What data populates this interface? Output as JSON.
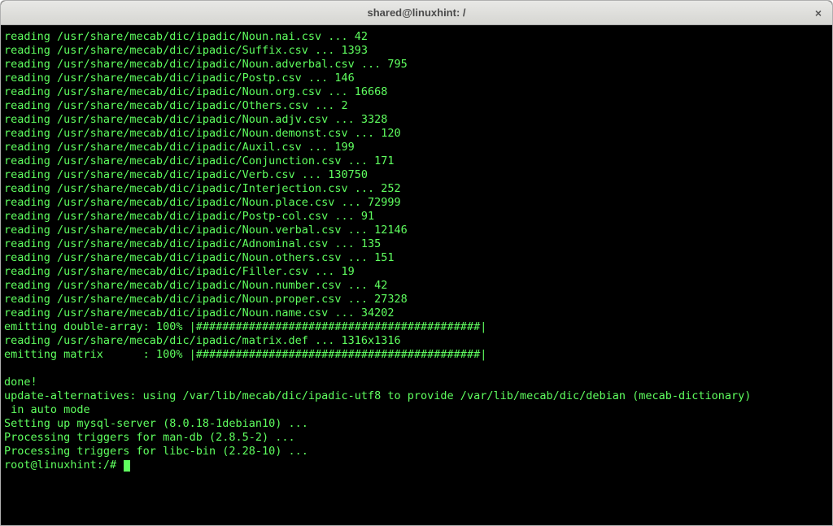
{
  "window": {
    "title": "shared@linuxhint: /"
  },
  "terminal": {
    "lines": [
      "reading /usr/share/mecab/dic/ipadic/Noun.nai.csv ... 42",
      "reading /usr/share/mecab/dic/ipadic/Suffix.csv ... 1393",
      "reading /usr/share/mecab/dic/ipadic/Noun.adverbal.csv ... 795",
      "reading /usr/share/mecab/dic/ipadic/Postp.csv ... 146",
      "reading /usr/share/mecab/dic/ipadic/Noun.org.csv ... 16668",
      "reading /usr/share/mecab/dic/ipadic/Others.csv ... 2",
      "reading /usr/share/mecab/dic/ipadic/Noun.adjv.csv ... 3328",
      "reading /usr/share/mecab/dic/ipadic/Noun.demonst.csv ... 120",
      "reading /usr/share/mecab/dic/ipadic/Auxil.csv ... 199",
      "reading /usr/share/mecab/dic/ipadic/Conjunction.csv ... 171",
      "reading /usr/share/mecab/dic/ipadic/Verb.csv ... 130750",
      "reading /usr/share/mecab/dic/ipadic/Interjection.csv ... 252",
      "reading /usr/share/mecab/dic/ipadic/Noun.place.csv ... 72999",
      "reading /usr/share/mecab/dic/ipadic/Postp-col.csv ... 91",
      "reading /usr/share/mecab/dic/ipadic/Noun.verbal.csv ... 12146",
      "reading /usr/share/mecab/dic/ipadic/Adnominal.csv ... 135",
      "reading /usr/share/mecab/dic/ipadic/Noun.others.csv ... 151",
      "reading /usr/share/mecab/dic/ipadic/Filler.csv ... 19",
      "reading /usr/share/mecab/dic/ipadic/Noun.number.csv ... 42",
      "reading /usr/share/mecab/dic/ipadic/Noun.proper.csv ... 27328",
      "reading /usr/share/mecab/dic/ipadic/Noun.name.csv ... 34202",
      "emitting double-array: 100% |###########################################| ",
      "reading /usr/share/mecab/dic/ipadic/matrix.def ... 1316x1316",
      "emitting matrix      : 100% |###########################################| ",
      "",
      "done!",
      "update-alternatives: using /var/lib/mecab/dic/ipadic-utf8 to provide /var/lib/mecab/dic/debian (mecab-dictionary)",
      " in auto mode",
      "Setting up mysql-server (8.0.18-1debian10) ...",
      "Processing triggers for man-db (2.8.5-2) ...",
      "Processing triggers for libc-bin (2.28-10) ..."
    ],
    "prompt": "root@linuxhint:/#"
  }
}
